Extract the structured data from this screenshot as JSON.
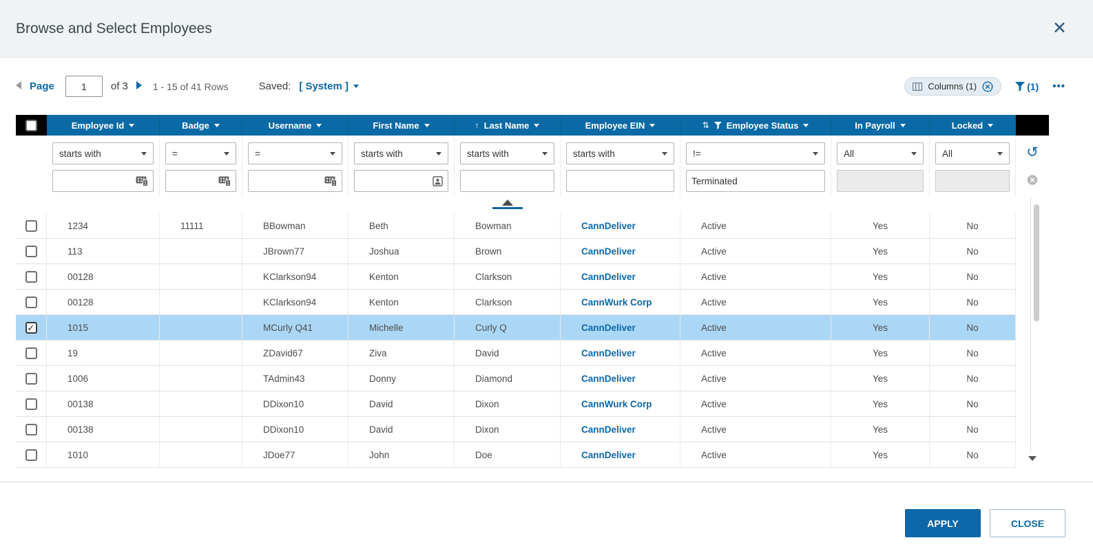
{
  "modal": {
    "title": "Browse and Select Employees",
    "close_glyph": "✕"
  },
  "toolbar": {
    "page_label": "Page",
    "page_value": "1",
    "page_total": "of 3",
    "rows_info": "1 - 15 of 41 Rows",
    "saved_label": "Saved:",
    "saved_value": "[ System ]",
    "columns_label": "Columns (1)",
    "filter_count": "(1)",
    "more_label": "•••"
  },
  "icons": {
    "sort_ascending": "↑",
    "sortable": "⇅",
    "reset": "↺",
    "check": "✓"
  },
  "table": {
    "columns": [
      {
        "key": "employee_id",
        "label": "Employee Id",
        "operator": "starts with",
        "filter_value": "",
        "filter_icon": "keypad-icon",
        "align": "left"
      },
      {
        "key": "badge",
        "label": "Badge",
        "operator": "=",
        "filter_value": "",
        "filter_icon": "keypad-icon",
        "align": "left"
      },
      {
        "key": "username",
        "label": "Username",
        "operator": "=",
        "filter_value": "",
        "filter_icon": "keypad-icon",
        "align": "left"
      },
      {
        "key": "first_name",
        "label": "First Name",
        "operator": "starts with",
        "filter_value": "",
        "filter_icon": "contact-icon",
        "align": "left"
      },
      {
        "key": "last_name",
        "label": "Last Name",
        "operator": "starts with",
        "filter_value": "",
        "filter_icon": null,
        "align": "left",
        "sorted": "asc"
      },
      {
        "key": "employee_ein",
        "label": "Employee EIN",
        "operator": "starts with",
        "filter_value": "",
        "filter_icon": null,
        "align": "left",
        "link": true
      },
      {
        "key": "employee_status",
        "label": "Employee Status",
        "operator": "!=",
        "filter_value": "Terminated",
        "filter_icon": null,
        "align": "left",
        "header_sort_filter_icons": true
      },
      {
        "key": "in_payroll",
        "label": "In Payroll",
        "operator": "All",
        "filter_value": "",
        "filter_disabled": true,
        "align": "center"
      },
      {
        "key": "locked",
        "label": "Locked",
        "operator": "All",
        "filter_value": "",
        "filter_disabled": true,
        "align": "center"
      }
    ],
    "rows": [
      {
        "selected": false,
        "cells": [
          "1234",
          "11111",
          "BBowman",
          "Beth",
          "Bowman",
          "CannDeliver",
          "Active",
          "Yes",
          "No"
        ]
      },
      {
        "selected": false,
        "cells": [
          "113",
          "",
          "JBrown77",
          "Joshua",
          "Brown",
          "CannDeliver",
          "Active",
          "Yes",
          "No"
        ]
      },
      {
        "selected": false,
        "cells": [
          "00128",
          "",
          "KClarkson94",
          "Kenton",
          "Clarkson",
          "CannDeliver",
          "Active",
          "Yes",
          "No"
        ]
      },
      {
        "selected": false,
        "cells": [
          "00128",
          "",
          "KClarkson94",
          "Kenton",
          "Clarkson",
          "CannWurk Corp",
          "Active",
          "Yes",
          "No"
        ]
      },
      {
        "selected": true,
        "cells": [
          "1015",
          "",
          "MCurly Q41",
          "Michelle",
          "Curly Q",
          "CannDeliver",
          "Active",
          "Yes",
          "No"
        ]
      },
      {
        "selected": false,
        "cells": [
          "19",
          "",
          "ZDavid67",
          "Ziva",
          "David",
          "CannDeliver",
          "Active",
          "Yes",
          "No"
        ]
      },
      {
        "selected": false,
        "cells": [
          "1006",
          "",
          "TAdmin43",
          "Donny",
          "Diamond",
          "CannDeliver",
          "Active",
          "Yes",
          "No"
        ]
      },
      {
        "selected": false,
        "cells": [
          "00138",
          "",
          "DDixon10",
          "David",
          "Dixon",
          "CannWurk Corp",
          "Active",
          "Yes",
          "No"
        ]
      },
      {
        "selected": false,
        "cells": [
          "00138",
          "",
          "DDixon10",
          "David",
          "Dixon",
          "CannDeliver",
          "Active",
          "Yes",
          "No"
        ]
      },
      {
        "selected": false,
        "cells": [
          "1010",
          "",
          "JDoe77",
          "John",
          "Doe",
          "CannDeliver",
          "Active",
          "Yes",
          "No"
        ]
      }
    ]
  },
  "footer": {
    "apply_label": "APPLY",
    "close_label": "CLOSE"
  },
  "colors": {
    "accent_blue": "#0c67a8",
    "header_blue": "#0a6aa5",
    "selected_row": "#abd7f6",
    "link_blue": "#0b67a9",
    "header_bar_bg": "#eff3f4"
  }
}
